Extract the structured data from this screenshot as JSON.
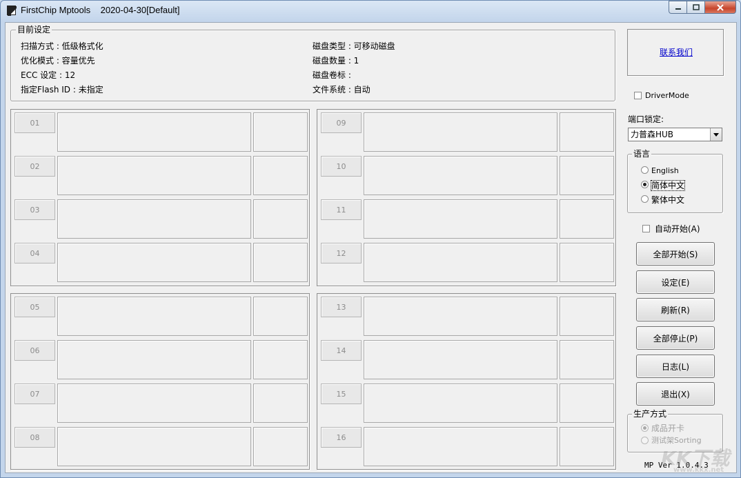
{
  "window": {
    "title": "FirstChip Mptools    2020-04-30[Default]"
  },
  "settings": {
    "legend": "目前设定",
    "left": [
      "扫描方式 : 低级格式化",
      "优化模式 : 容量优先",
      "ECC 设定 : 12",
      "指定Flash ID : 未指定"
    ],
    "right": [
      "磁盘类型 : 可移动磁盘",
      "磁盘数量 : 1",
      "磁盘卷标 :",
      "文件系统 : 自动"
    ]
  },
  "slots": [
    "01",
    "02",
    "03",
    "04",
    "09",
    "10",
    "11",
    "12",
    "05",
    "06",
    "07",
    "08",
    "13",
    "14",
    "15",
    "16"
  ],
  "sidebar": {
    "contact_link": "联系我们",
    "driver_mode_label": "DriverMode",
    "driver_mode_checked": false,
    "port_lock_label": "端口锁定:",
    "port_lock_value": "力普森HUB",
    "language": {
      "legend": "语言",
      "options": [
        "English",
        "简体中文",
        "繁体中文"
      ],
      "selected": "简体中文"
    },
    "auto_start_label": "自动开始(A)",
    "auto_start_checked": false,
    "buttons": {
      "start_all": "全部开始(S)",
      "settings": "设定(E)",
      "refresh": "刷新(R)",
      "stop_all": "全部停止(P)",
      "log": "日志(L)",
      "exit": "退出(X)"
    },
    "production": {
      "legend": "生产方式",
      "options": [
        "成品开卡",
        "测试架Sorting"
      ],
      "selected": "成品开卡"
    },
    "version": "MP Ver 1.0.4.3"
  },
  "watermark": {
    "text": "KK下载",
    "url": "www.kkx.net"
  }
}
